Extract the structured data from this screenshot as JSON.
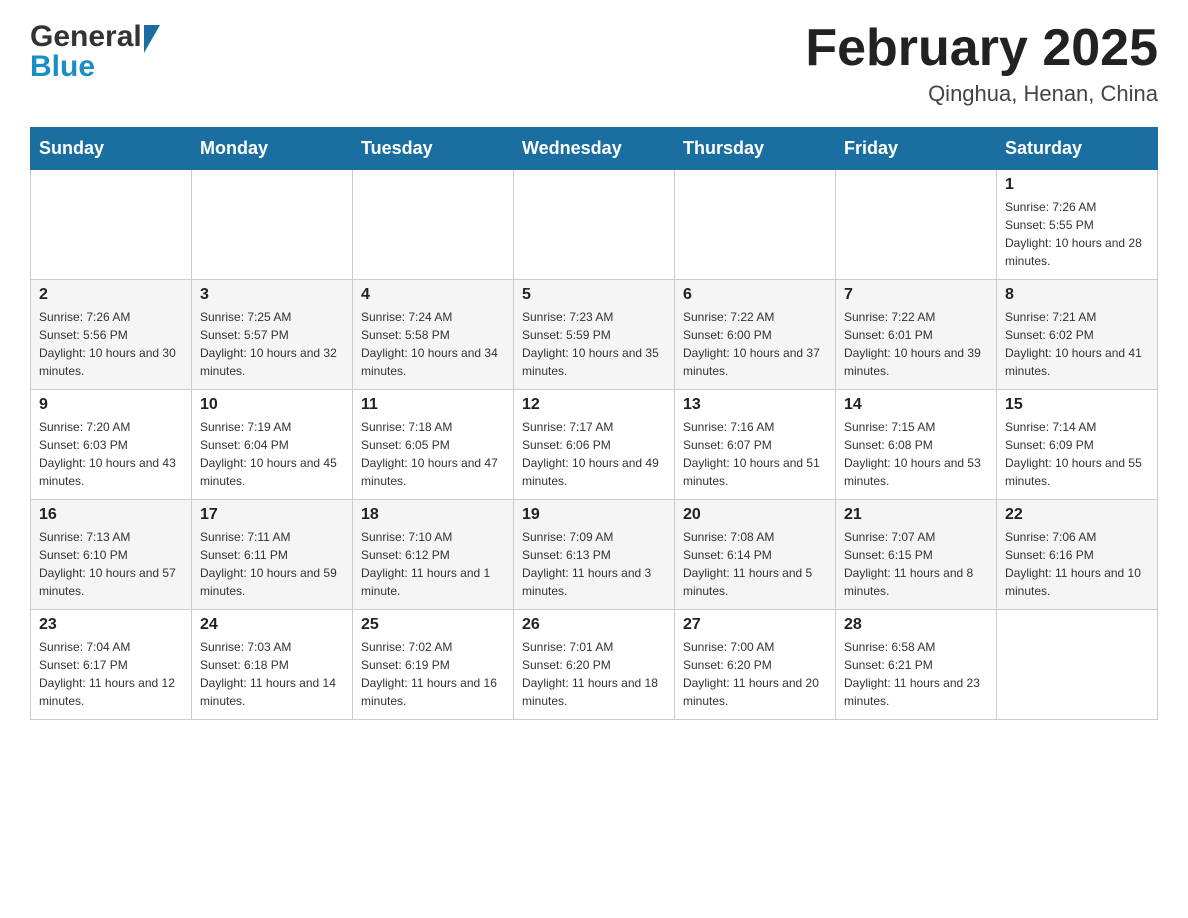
{
  "header": {
    "logo": {
      "general": "General",
      "blue": "Blue"
    },
    "title": "February 2025",
    "location": "Qinghua, Henan, China"
  },
  "weekdays": [
    "Sunday",
    "Monday",
    "Tuesday",
    "Wednesday",
    "Thursday",
    "Friday",
    "Saturday"
  ],
  "weeks": [
    [
      {
        "day": "",
        "sunrise": "",
        "sunset": "",
        "daylight": ""
      },
      {
        "day": "",
        "sunrise": "",
        "sunset": "",
        "daylight": ""
      },
      {
        "day": "",
        "sunrise": "",
        "sunset": "",
        "daylight": ""
      },
      {
        "day": "",
        "sunrise": "",
        "sunset": "",
        "daylight": ""
      },
      {
        "day": "",
        "sunrise": "",
        "sunset": "",
        "daylight": ""
      },
      {
        "day": "",
        "sunrise": "",
        "sunset": "",
        "daylight": ""
      },
      {
        "day": "1",
        "sunrise": "Sunrise: 7:26 AM",
        "sunset": "Sunset: 5:55 PM",
        "daylight": "Daylight: 10 hours and 28 minutes."
      }
    ],
    [
      {
        "day": "2",
        "sunrise": "Sunrise: 7:26 AM",
        "sunset": "Sunset: 5:56 PM",
        "daylight": "Daylight: 10 hours and 30 minutes."
      },
      {
        "day": "3",
        "sunrise": "Sunrise: 7:25 AM",
        "sunset": "Sunset: 5:57 PM",
        "daylight": "Daylight: 10 hours and 32 minutes."
      },
      {
        "day": "4",
        "sunrise": "Sunrise: 7:24 AM",
        "sunset": "Sunset: 5:58 PM",
        "daylight": "Daylight: 10 hours and 34 minutes."
      },
      {
        "day": "5",
        "sunrise": "Sunrise: 7:23 AM",
        "sunset": "Sunset: 5:59 PM",
        "daylight": "Daylight: 10 hours and 35 minutes."
      },
      {
        "day": "6",
        "sunrise": "Sunrise: 7:22 AM",
        "sunset": "Sunset: 6:00 PM",
        "daylight": "Daylight: 10 hours and 37 minutes."
      },
      {
        "day": "7",
        "sunrise": "Sunrise: 7:22 AM",
        "sunset": "Sunset: 6:01 PM",
        "daylight": "Daylight: 10 hours and 39 minutes."
      },
      {
        "day": "8",
        "sunrise": "Sunrise: 7:21 AM",
        "sunset": "Sunset: 6:02 PM",
        "daylight": "Daylight: 10 hours and 41 minutes."
      }
    ],
    [
      {
        "day": "9",
        "sunrise": "Sunrise: 7:20 AM",
        "sunset": "Sunset: 6:03 PM",
        "daylight": "Daylight: 10 hours and 43 minutes."
      },
      {
        "day": "10",
        "sunrise": "Sunrise: 7:19 AM",
        "sunset": "Sunset: 6:04 PM",
        "daylight": "Daylight: 10 hours and 45 minutes."
      },
      {
        "day": "11",
        "sunrise": "Sunrise: 7:18 AM",
        "sunset": "Sunset: 6:05 PM",
        "daylight": "Daylight: 10 hours and 47 minutes."
      },
      {
        "day": "12",
        "sunrise": "Sunrise: 7:17 AM",
        "sunset": "Sunset: 6:06 PM",
        "daylight": "Daylight: 10 hours and 49 minutes."
      },
      {
        "day": "13",
        "sunrise": "Sunrise: 7:16 AM",
        "sunset": "Sunset: 6:07 PM",
        "daylight": "Daylight: 10 hours and 51 minutes."
      },
      {
        "day": "14",
        "sunrise": "Sunrise: 7:15 AM",
        "sunset": "Sunset: 6:08 PM",
        "daylight": "Daylight: 10 hours and 53 minutes."
      },
      {
        "day": "15",
        "sunrise": "Sunrise: 7:14 AM",
        "sunset": "Sunset: 6:09 PM",
        "daylight": "Daylight: 10 hours and 55 minutes."
      }
    ],
    [
      {
        "day": "16",
        "sunrise": "Sunrise: 7:13 AM",
        "sunset": "Sunset: 6:10 PM",
        "daylight": "Daylight: 10 hours and 57 minutes."
      },
      {
        "day": "17",
        "sunrise": "Sunrise: 7:11 AM",
        "sunset": "Sunset: 6:11 PM",
        "daylight": "Daylight: 10 hours and 59 minutes."
      },
      {
        "day": "18",
        "sunrise": "Sunrise: 7:10 AM",
        "sunset": "Sunset: 6:12 PM",
        "daylight": "Daylight: 11 hours and 1 minute."
      },
      {
        "day": "19",
        "sunrise": "Sunrise: 7:09 AM",
        "sunset": "Sunset: 6:13 PM",
        "daylight": "Daylight: 11 hours and 3 minutes."
      },
      {
        "day": "20",
        "sunrise": "Sunrise: 7:08 AM",
        "sunset": "Sunset: 6:14 PM",
        "daylight": "Daylight: 11 hours and 5 minutes."
      },
      {
        "day": "21",
        "sunrise": "Sunrise: 7:07 AM",
        "sunset": "Sunset: 6:15 PM",
        "daylight": "Daylight: 11 hours and 8 minutes."
      },
      {
        "day": "22",
        "sunrise": "Sunrise: 7:06 AM",
        "sunset": "Sunset: 6:16 PM",
        "daylight": "Daylight: 11 hours and 10 minutes."
      }
    ],
    [
      {
        "day": "23",
        "sunrise": "Sunrise: 7:04 AM",
        "sunset": "Sunset: 6:17 PM",
        "daylight": "Daylight: 11 hours and 12 minutes."
      },
      {
        "day": "24",
        "sunrise": "Sunrise: 7:03 AM",
        "sunset": "Sunset: 6:18 PM",
        "daylight": "Daylight: 11 hours and 14 minutes."
      },
      {
        "day": "25",
        "sunrise": "Sunrise: 7:02 AM",
        "sunset": "Sunset: 6:19 PM",
        "daylight": "Daylight: 11 hours and 16 minutes."
      },
      {
        "day": "26",
        "sunrise": "Sunrise: 7:01 AM",
        "sunset": "Sunset: 6:20 PM",
        "daylight": "Daylight: 11 hours and 18 minutes."
      },
      {
        "day": "27",
        "sunrise": "Sunrise: 7:00 AM",
        "sunset": "Sunset: 6:20 PM",
        "daylight": "Daylight: 11 hours and 20 minutes."
      },
      {
        "day": "28",
        "sunrise": "Sunrise: 6:58 AM",
        "sunset": "Sunset: 6:21 PM",
        "daylight": "Daylight: 11 hours and 23 minutes."
      },
      {
        "day": "",
        "sunrise": "",
        "sunset": "",
        "daylight": ""
      }
    ]
  ]
}
